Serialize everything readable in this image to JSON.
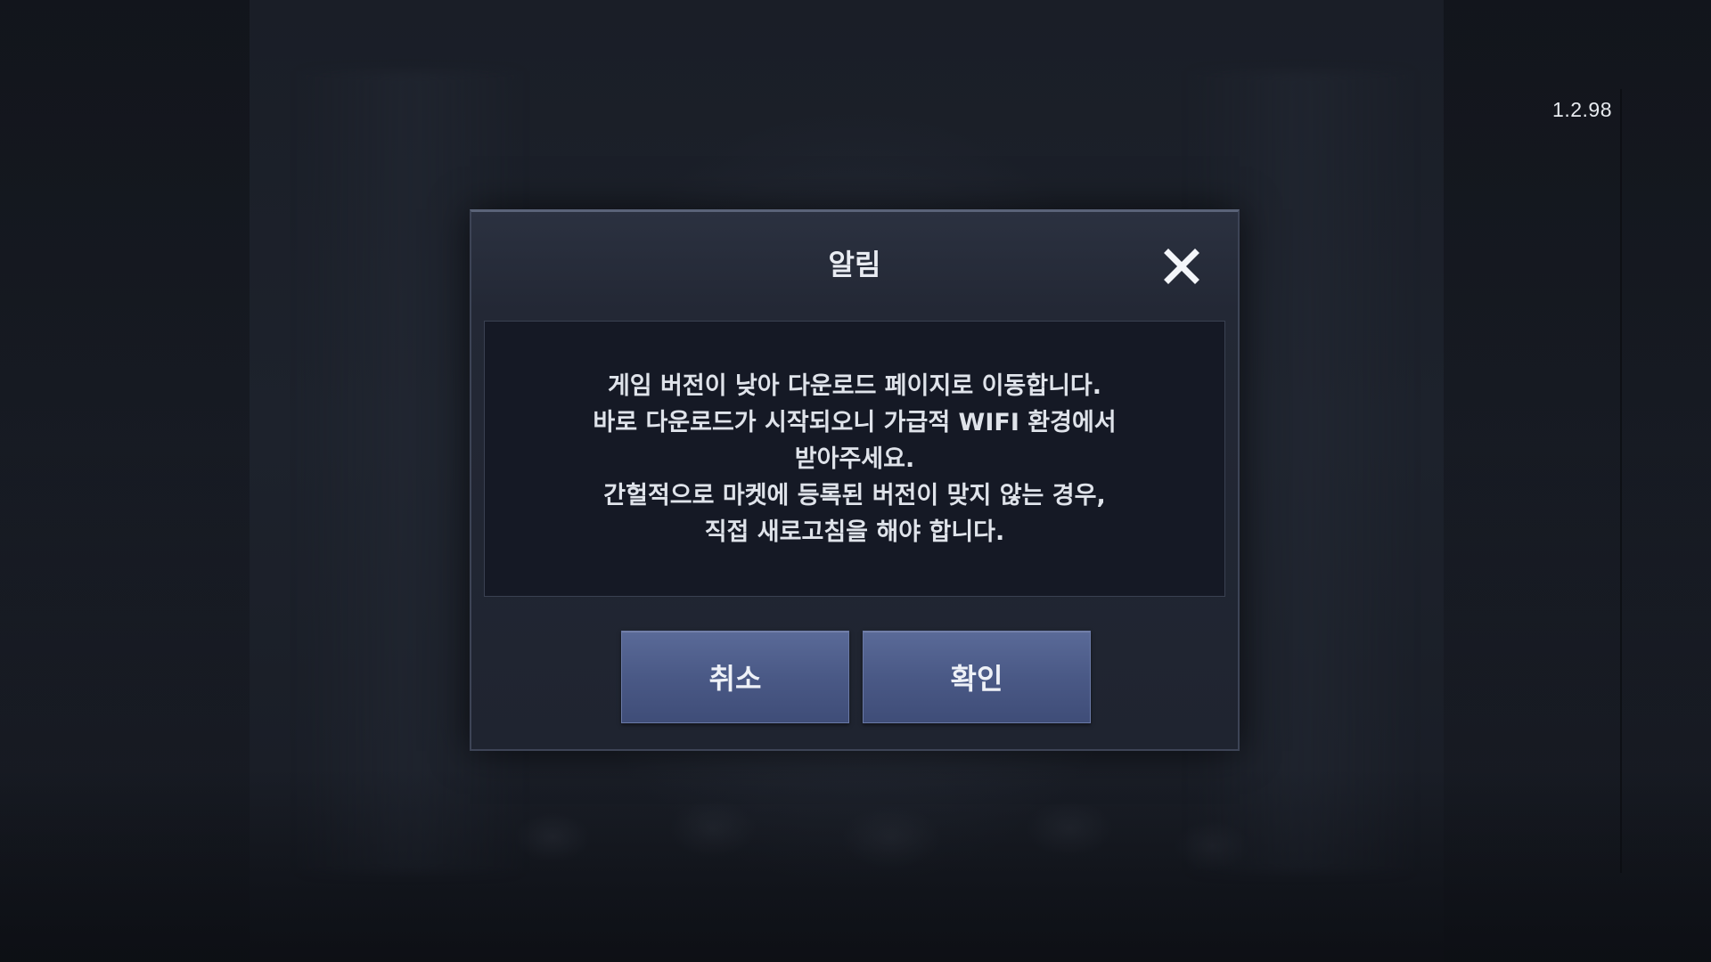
{
  "version": "1.2.98",
  "dialog": {
    "title": "알림",
    "close_icon": "close-icon",
    "message_lines": [
      "게임 버전이 낮아 다운로드 페이지로 이동합니다.",
      "바로 다운로드가 시작되오니 가급적 WIFI 환경에서",
      "받아주세요.",
      "간헐적으로 마켓에 등록된 버전이 맞지 않는 경우,",
      "직접 새로고침을 해야 합니다."
    ],
    "cancel_label": "취소",
    "confirm_label": "확인"
  },
  "colors": {
    "button": "#4a5986",
    "message_background": "#151925",
    "dialog_background": "#232835"
  }
}
